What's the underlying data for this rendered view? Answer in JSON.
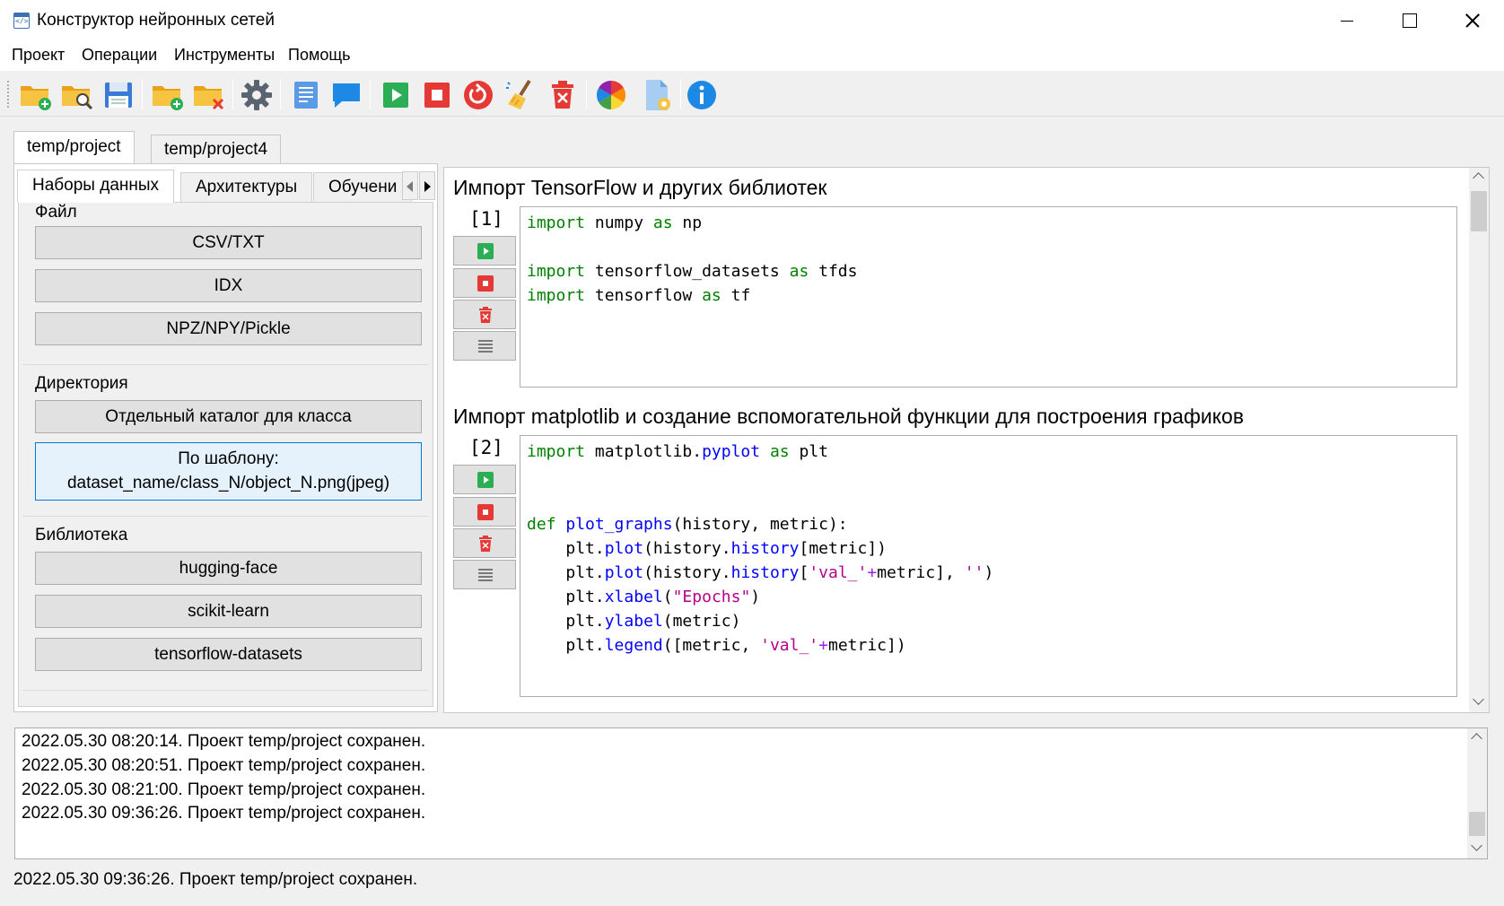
{
  "window": {
    "title": "Конструктор нейронных сетей"
  },
  "menu": {
    "items": [
      "Проект",
      "Операции",
      "Инструменты",
      "Помощь"
    ]
  },
  "toolbar": {
    "icons": [
      "new-project-icon",
      "open-project-icon",
      "save-icon",
      "add-folder-icon",
      "remove-folder-icon",
      "settings-icon",
      "notes-icon",
      "comment-icon",
      "run-icon",
      "stop-icon",
      "restart-icon",
      "clear-icon",
      "delete-icon",
      "color-wheel-icon",
      "file-settings-icon",
      "info-icon"
    ]
  },
  "colors": {
    "run_green": "#2bae55",
    "stop_red": "#e53935",
    "info_blue": "#1e88e5",
    "keyword": "#008000",
    "function": "#0000ff",
    "string": "#b5008c"
  },
  "project_tabs": [
    "temp/project",
    "temp/project4"
  ],
  "left_tabs": [
    "Наборы данных",
    "Архитектуры",
    "Обучени"
  ],
  "datasets": {
    "file_group": {
      "title": "Файл",
      "buttons": [
        "CSV/TXT",
        "IDX",
        "NPZ/NPY/Pickle"
      ]
    },
    "dir_group": {
      "title": "Директория",
      "buttons": [
        "Отдельный каталог для класса"
      ],
      "template_line1": "По шаблону:",
      "template_line2": "dataset_name/class_N/object_N.png(jpeg)"
    },
    "lib_group": {
      "title": "Библиотека",
      "buttons": [
        "hugging-face",
        "scikit-learn",
        "tensorflow-datasets"
      ]
    }
  },
  "cells": [
    {
      "title": "Импорт TensorFlow и других библиотек",
      "number": "[1]"
    },
    {
      "title": "Импорт matplotlib и создание вспомогательной функции для построения графиков",
      "number": "[2]"
    }
  ],
  "code": {
    "import": "import",
    "as": "as",
    "def": "def",
    "c1": {
      "numpy": " numpy ",
      "np": " np",
      "tfds_mod": " tensorflow_datasets ",
      "tfds": " tfds",
      "tf_mod": " tensorflow ",
      "tf": " tf"
    },
    "c2": {
      "mpl": " matplotlib.",
      "pyplot": "pyplot",
      "plt": " plt",
      "fn_name": "plot_graphs",
      "sig": "(history, metric):",
      "plt_dot": "plt.",
      "plot": "plot",
      "hist_open": "(history.",
      "history": "history",
      "l2_tail": "[metric])",
      "l3_open": "[",
      "val_str": "'val_'",
      "plus": "+",
      "l3_mid": "metric], ",
      "empty_str": "''",
      "close": ")",
      "xlabel": "xlabel",
      "epochs_str": "\"Epochs\"",
      "open": "(",
      "ylabel": "ylabel",
      "l5_tail": "(metric)",
      "legend": "legend",
      "l6_open": "([metric, ",
      "l6_tail": "metric])"
    }
  },
  "log": {
    "lines": [
      "2022.05.30 08:20:14. Проект temp/project сохранен.",
      "2022.05.30 08:20:51. Проект temp/project сохранен.",
      "2022.05.30 08:21:00. Проект temp/project сохранен.",
      "2022.05.30 09:36:26. Проект temp/project сохранен."
    ]
  },
  "status": "2022.05.30 09:36:26. Проект temp/project сохранен."
}
